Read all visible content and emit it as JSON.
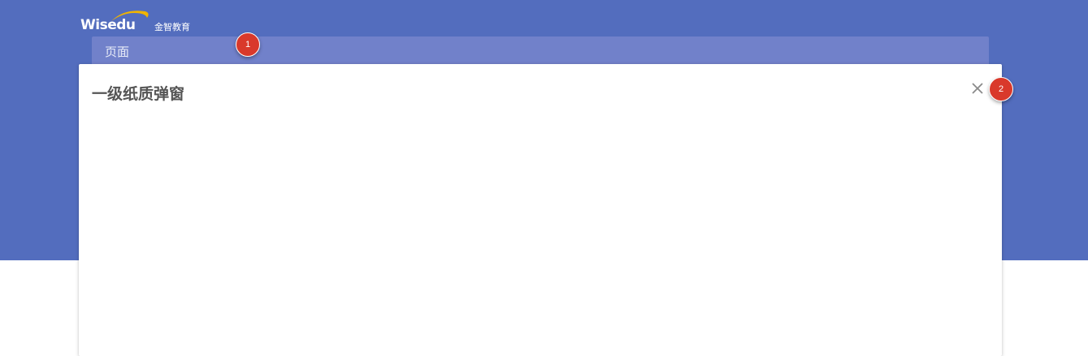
{
  "brand": {
    "logo_word": "Wisedu",
    "logo_cn": "金智教育"
  },
  "page_bar": {
    "label": "页面"
  },
  "dialog": {
    "title": "一级纸质弹窗",
    "close_icon": "close-icon"
  },
  "annotations": [
    {
      "label": "1"
    },
    {
      "label": "2"
    }
  ],
  "colors": {
    "header": "#536dbe",
    "page_bar": "#7181ca",
    "badge": "#d9392b",
    "logo_swoosh": "#f0b400"
  }
}
